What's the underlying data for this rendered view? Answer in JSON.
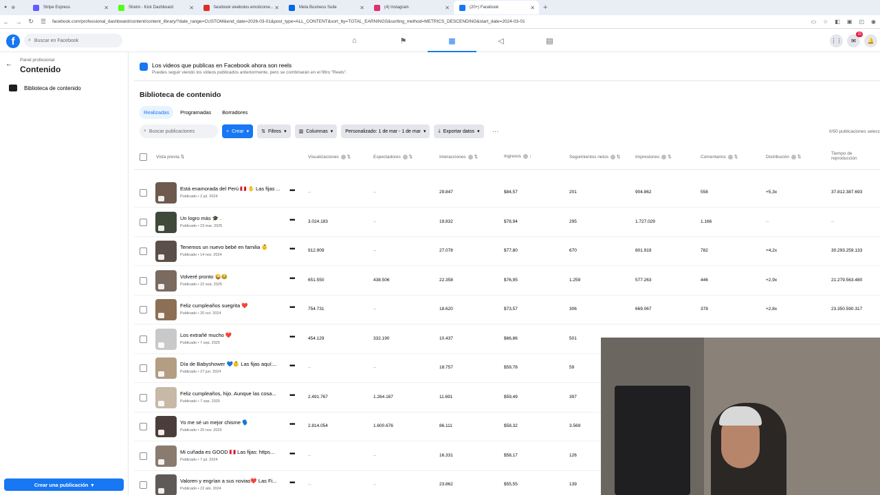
{
  "browser": {
    "tabs": [
      {
        "label": "Stripe Express",
        "color": "#635bff"
      },
      {
        "label": "Streim - Kick Dashboard",
        "color": "#53fc18"
      },
      {
        "label": "facebook vieebolos emoticonw...",
        "color": "#d93025"
      },
      {
        "label": "Meta Business Suite",
        "color": "#0668e1"
      },
      {
        "label": "(4) Instagram",
        "color": "#e1306c"
      },
      {
        "label": "(20+) Facebook",
        "color": "#1877f2"
      }
    ],
    "url": "facebook.com/professional_dashboard/content/content_library/?date_range=CUSTOM&end_date=2026-03-01&post_type=ALL_CONTENT&sort_by=TOTAL_EARNINGS&sorting_method=METRICS_DESCENDING&start_date=2024-03-01"
  },
  "fb": {
    "search_placeholder": "Buscar en Facebook",
    "notif_badge": "15"
  },
  "sidebar": {
    "small_label": "Panel profesional",
    "title": "Contenido",
    "item": "Biblioteca de contenido",
    "create_button": "Crear una publicación"
  },
  "banner": {
    "title": "Los videos que publicas en Facebook ahora son reels",
    "subtitle": "Puedes seguir viendo los videos publicados anteriormente, pero se combinarán en el filtro \"Reels\"."
  },
  "library": {
    "title": "Biblioteca de contenido",
    "tabs": [
      "Realizadas",
      "Programadas",
      "Borradores"
    ],
    "search_placeholder": "Buscar publicaciones",
    "create": "Crear",
    "filters": "Filtros",
    "columns": "Columnas",
    "date_range": "Personalizado: 1 de mar - 1 de mar",
    "export": "Exportar datos",
    "count": "0/50 publicaciones selecc"
  },
  "columns": [
    "Vista previa",
    "Visualizaciones",
    "Espectadores",
    "Interacciones",
    "Ingresos",
    "Seguimientos netos",
    "Impresiones",
    "Comentarios",
    "Distribución",
    "Tiempo de reproducción"
  ],
  "rows": [
    {
      "title": "Está enamorada del Perú 🇵🇪 ✋ Las fijas ...",
      "date": "Publicado • 2 jul. 2024",
      "views": "--",
      "viewers": "--",
      "interactions": "29.847",
      "income": "$84,57",
      "follows": "201",
      "impressions": "904.862",
      "comments": "558",
      "dist": "+5,3x",
      "time": "37.812.387.693"
    },
    {
      "title": "Un logro más 🎓 .",
      "date": "Publicado • 23 mar. 2025",
      "views": "3.024.183",
      "viewers": "--",
      "interactions": "19.832",
      "income": "$78,94",
      "follows": "295",
      "impressions": "1.727.029",
      "comments": "1.166",
      "dist": "--",
      "time": "--"
    },
    {
      "title": "Tenemos un nuevo bebé en familia 👶",
      "date": "Publicado • 14 nov. 2024",
      "views": "912.909",
      "viewers": "--",
      "interactions": "27.078",
      "income": "$77,80",
      "follows": "670",
      "impressions": "801.919",
      "comments": "782",
      "dist": "+4,2x",
      "time": "30.293.259.133"
    },
    {
      "title": "Volveré pronto 😜😂",
      "date": "Publicado • 22 sep. 2025",
      "views": "651.550",
      "viewers": "438.506",
      "interactions": "22.358",
      "income": "$76,95",
      "follows": "1.259",
      "impressions": "577.263",
      "comments": "446",
      "dist": "+2,9x",
      "time": "21.279.563.480"
    },
    {
      "title": "Feliz cumpleaños suegrita ❤️",
      "date": "Publicado • 20 oct. 2024",
      "views": "754.731",
      "viewers": "--",
      "interactions": "18.620",
      "income": "$73,57",
      "follows": "306",
      "impressions": "669.067",
      "comments": "378",
      "dist": "+2,8x",
      "time": "23.350.590.317"
    },
    {
      "title": "Los extrañé mucho ❤️",
      "date": "Publicado • 7 sep. 2025",
      "views": "454.129",
      "viewers": "332.190",
      "interactions": "10.437",
      "income": "$66,86",
      "follows": "501",
      "impressions": "",
      "comments": "",
      "dist": "",
      "time": ""
    },
    {
      "title": "Día de Babyshower 💙👶 Las fijas aquí:...",
      "date": "Publicado • 27 jun. 2024",
      "views": "--",
      "viewers": "--",
      "interactions": "18.757",
      "income": "$59,78",
      "follows": "59",
      "impressions": "",
      "comments": "",
      "dist": "",
      "time": ""
    },
    {
      "title": "Feliz cumpleaños, hijo. Aunque las cosa...",
      "date": "Publicado • 7 sep. 2025",
      "views": "2.491.767",
      "viewers": "1.264.167",
      "interactions": "11.691",
      "income": "$59,49",
      "follows": "397",
      "impressions": "",
      "comments": "",
      "dist": "",
      "time": ""
    },
    {
      "title": "Yo me sé un mejor chisme 🗣️",
      "date": "Publicado • 25 nov. 2025",
      "views": "2.814.054",
      "viewers": "1.600.676",
      "interactions": "86.111",
      "income": "$58,32",
      "follows": "3.569",
      "impressions": "",
      "comments": "",
      "dist": "",
      "time": ""
    },
    {
      "title": "Mi cuñada es GOOD 🇵🇪 Las fijas: https...",
      "date": "Publicado • 7 jul. 2024",
      "views": "--",
      "viewers": "--",
      "interactions": "16.331",
      "income": "$58,17",
      "follows": "126",
      "impressions": "",
      "comments": "",
      "dist": "",
      "time": ""
    },
    {
      "title": "Valoren y engrían a sus novias❤️ Las Fi...",
      "date": "Publicado • 22 abr. 2024",
      "views": "--",
      "viewers": "--",
      "interactions": "23.862",
      "income": "$55,55",
      "follows": "139",
      "impressions": "",
      "comments": "",
      "dist": "",
      "time": ""
    }
  ]
}
